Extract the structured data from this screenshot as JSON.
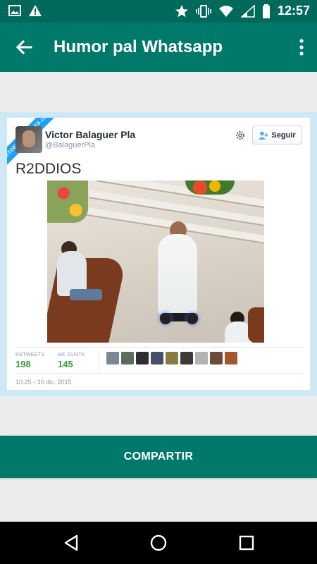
{
  "status_bar": {
    "time": "12:57",
    "icons": [
      "image-icon",
      "warning-icon",
      "star-icon",
      "vibrate-icon",
      "wifi-icon",
      "signal-icon",
      "battery-icon"
    ]
  },
  "app_bar": {
    "title": "Humor pal Whatsapp",
    "back_icon": "arrow-back-icon",
    "menu_icon": "more-vert-icon",
    "color": "#00796b"
  },
  "tweet": {
    "ribbon": "VISTOENLASREDES.com",
    "name": "Victor Balaguer Pla",
    "handle": "@BalaguerPla",
    "follow_label": "Seguir",
    "text": "R2DDIOS",
    "retweets_label": "RETWEETS",
    "retweets": "198",
    "likes_label": "ME GUSTA",
    "likes": "145",
    "date": "10:25 - 30 dic. 2015"
  },
  "share_button": {
    "label": "COMPARTIR"
  },
  "nav_bar": {
    "icons": [
      "back-triangle-icon",
      "home-circle-icon",
      "recents-square-icon"
    ]
  },
  "colors": {
    "primary": "#00796b",
    "primary_dark": "#00695c",
    "background": "#ececec",
    "tweet_frame": "#cde9f7",
    "stat_green": "#3a9a3a"
  }
}
